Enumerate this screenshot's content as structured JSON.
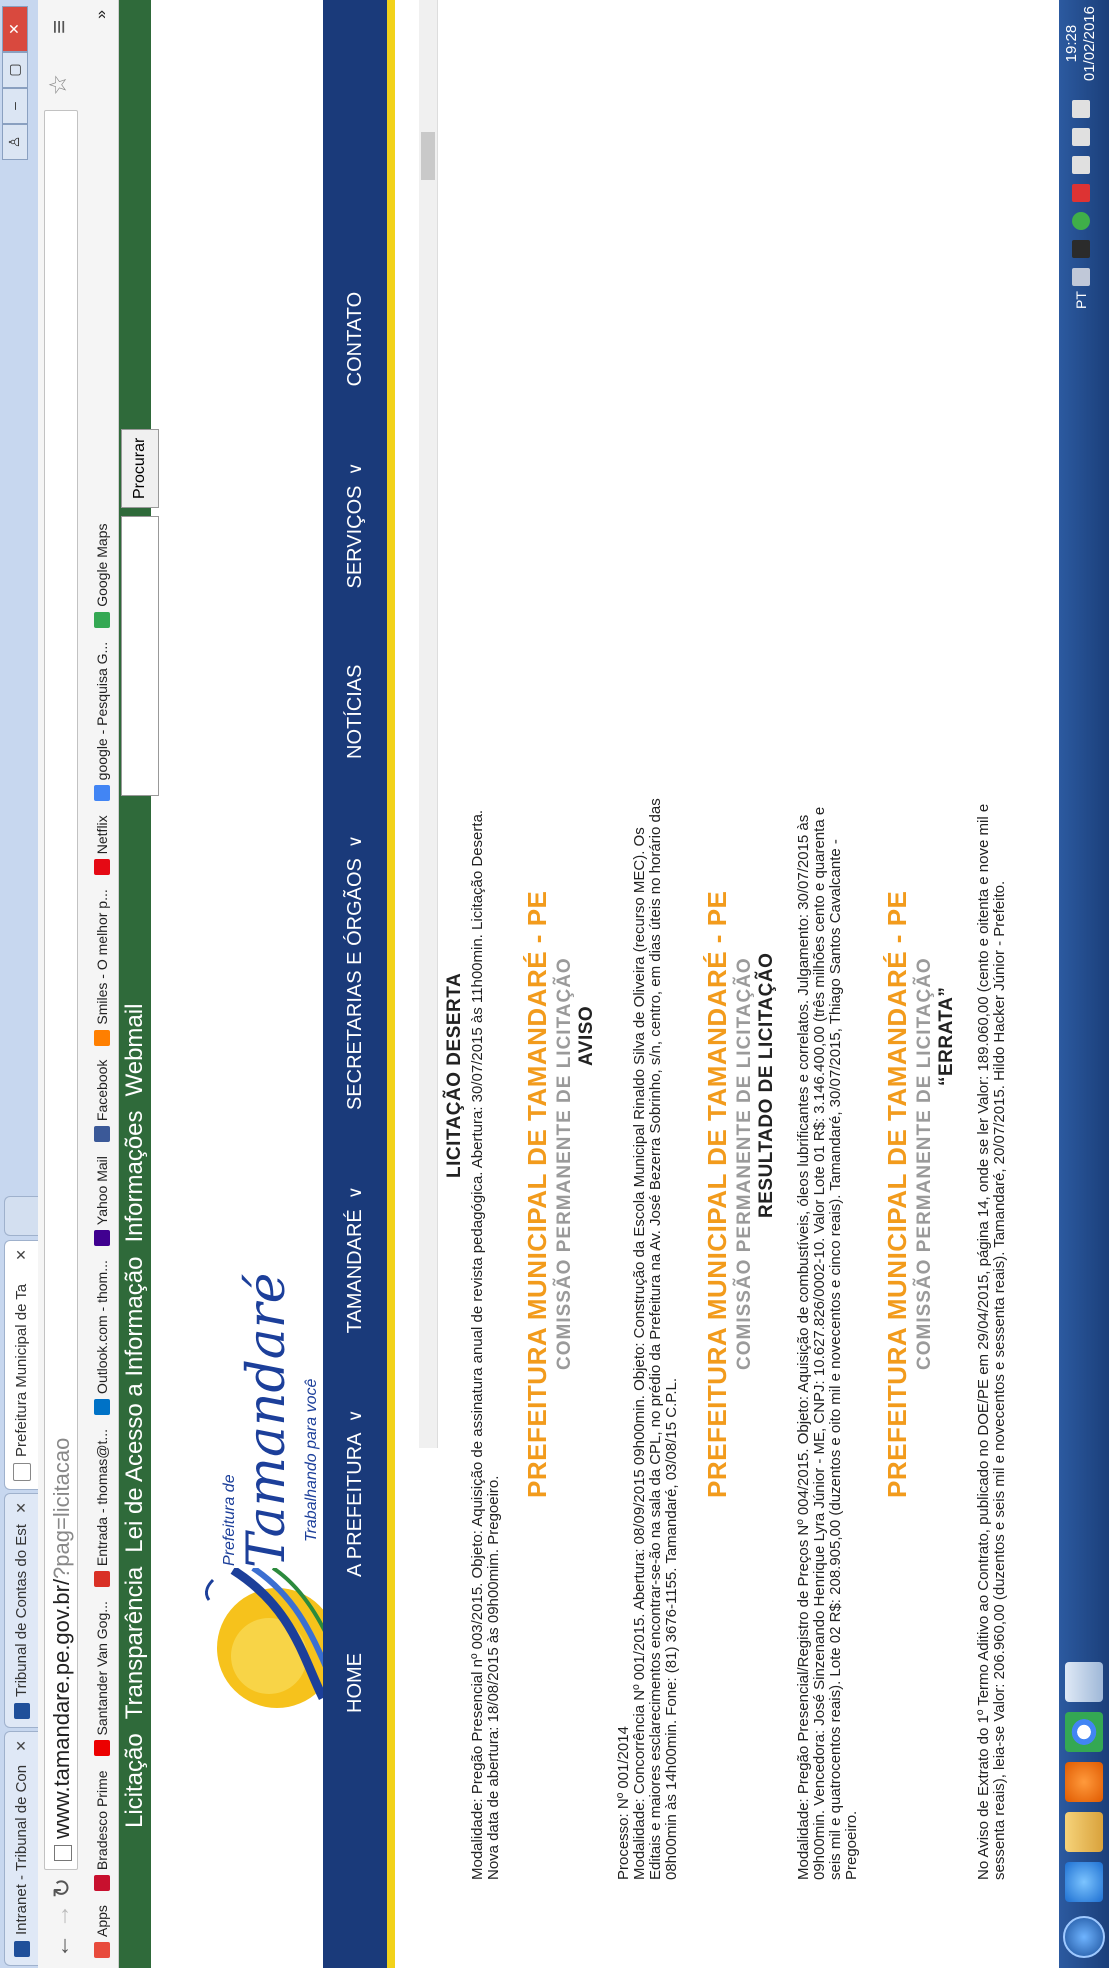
{
  "browser": {
    "tabs": [
      {
        "label": "Intranet - Tribunal de Con",
        "active": false
      },
      {
        "label": "Tribunal de Contas do Est",
        "active": false
      },
      {
        "label": "Prefeitura Municipal de Ta",
        "active": true
      }
    ],
    "url": "www.tamandare.pe.gov.br/",
    "url_query": "?pag=licitacao",
    "bookmarks": [
      {
        "label": "Apps",
        "icon": "apps-grid-icon",
        "color": "#e84b3c"
      },
      {
        "label": "Bradesco Prime",
        "icon": "bradesco-icon",
        "color": "#c8102e"
      },
      {
        "label": "Santander Van Gog...",
        "icon": "santander-icon",
        "color": "#ec0000"
      },
      {
        "label": "Entrada - thomas@t...",
        "icon": "gmail-icon",
        "color": "#d93025"
      },
      {
        "label": "Outlook.com - thom...",
        "icon": "outlook-icon",
        "color": "#0072c6"
      },
      {
        "label": "Yahoo Mail",
        "icon": "yahoo-icon",
        "color": "#400090"
      },
      {
        "label": "Facebook",
        "icon": "facebook-icon",
        "color": "#3b5998"
      },
      {
        "label": "Smiles - O melhor p...",
        "icon": "smiles-icon",
        "color": "#ff7f00"
      },
      {
        "label": "Netflix",
        "icon": "netflix-icon",
        "color": "#e50914"
      },
      {
        "label": "google - Pesquisa G...",
        "icon": "google-icon",
        "color": "#4285f4"
      },
      {
        "label": "Google Maps",
        "icon": "maps-icon",
        "color": "#34a853"
      }
    ],
    "bookmarks_more": "»"
  },
  "site": {
    "topnav": [
      "Licitação",
      "Transparência",
      "Lei de Acesso a Informação",
      "Informações",
      "Webmail"
    ],
    "search_button": "Procurar",
    "logo_prefix": "Prefeitura de",
    "logo_name": "Tamandaré",
    "logo_tagline": "Trabalhando para você",
    "menu": [
      {
        "label": "HOME",
        "dropdown": false
      },
      {
        "label": "A PREFEITURA",
        "dropdown": true
      },
      {
        "label": "TAMANDARÉ",
        "dropdown": true
      },
      {
        "label": "SECRETARIAS E ÓRGÃOS",
        "dropdown": true
      },
      {
        "label": "NOTÍCIAS",
        "dropdown": false
      },
      {
        "label": "SERVIÇOS",
        "dropdown": true
      },
      {
        "label": "CONTATO",
        "dropdown": false
      }
    ],
    "chevron": "∨"
  },
  "content": {
    "s1_heading": "LICITAÇÃO DESERTA",
    "s1_text1": "Modalidade: Pregão Presencial nº 003/2015. Objeto: Aquisição de assinatura anual de revista pedagógica. Abertura: 30/07/2015 às 11h00min. Licitação Deserta.",
    "s1_text2": "Nova data de abertura: 18/08/2015 às 09h00mim. Pregoeiro.",
    "prefeitura": "PREFEITURA MUNICIPAL DE TAMANDARÉ - PE",
    "comissao": "COMISSÃO PERMANENTE DE LICITAÇÃO",
    "s2_heading": "AVISO",
    "s2_text1": "Processo: Nº 001/2014",
    "s2_text2": "Modalidade: Concorrência Nº 001/2015. Abertura: 08/09/2015 09h00min. Objeto: Construção da Escola Municipal Rinaldo Silva de Oliveira (recurso MEC). Os",
    "s2_text3": "Editais e maiores esclarecimentos encontrar-se-ão na sala da CPL, no prédio da Prefeitura na Av. José Bezerra Sobrinho, s/n, centro, em dias úteis no horário das",
    "s2_text4": "08h00min às 14h00min. Fone: (81) 3676-1155. Tamandaré, 03/08/15 C.P.L.",
    "s3_heading": "RESULTADO DE LICITAÇÃO",
    "s3_text1": "Modalidade: Pregão Presencial/Registro de Preços Nº 004/2015. Objeto: Aquisição de combustíveis, óleos lubrificantes e correlatos. Julgamento: 30/07/2015 às",
    "s3_text2": "09h00min. Vencedora: José Sinzenando Henrique Lyra Júnior - ME, CNPJ: 10.627.826/0002-10. Valor Lote 01 R$: 3.146.400,00 (três milhões cento e quarenta e",
    "s3_text3": "seis mil e quatrocentos reais). Lote 02 R$: 208.905,00 (duzentos e oito mil e novecentos e cinco reais). Tamandaré, 30/07/2015, Thiago Santos Cavalcante -",
    "s3_text4": "Pregoeiro.",
    "s4_heading": "“ERRATA”",
    "s4_text1": "No Aviso de Extrato do 1º Termo Aditivo ao Contrato, publicado no DOE/PE em 29/04/2015, página 14, onde se ler Valor: 189.060,00 (cento e oitenta e nove mil e",
    "s4_text2": "sessenta reais), leia-se Valor: 206.960,00 (duzentos e seis mil e novecentos e sessenta reais). Tamandaré, 20/07/2015. Hildo Hacker Júnior - Prefeito."
  },
  "taskbar": {
    "lang": "PT",
    "time": "19:28",
    "date": "01/02/2016"
  },
  "colors": {
    "green_bar": "#2f6a3a",
    "nav_blue": "#1a3a7a",
    "nav_yellow": "#f2d21a",
    "orange_title": "#f29b1c"
  }
}
